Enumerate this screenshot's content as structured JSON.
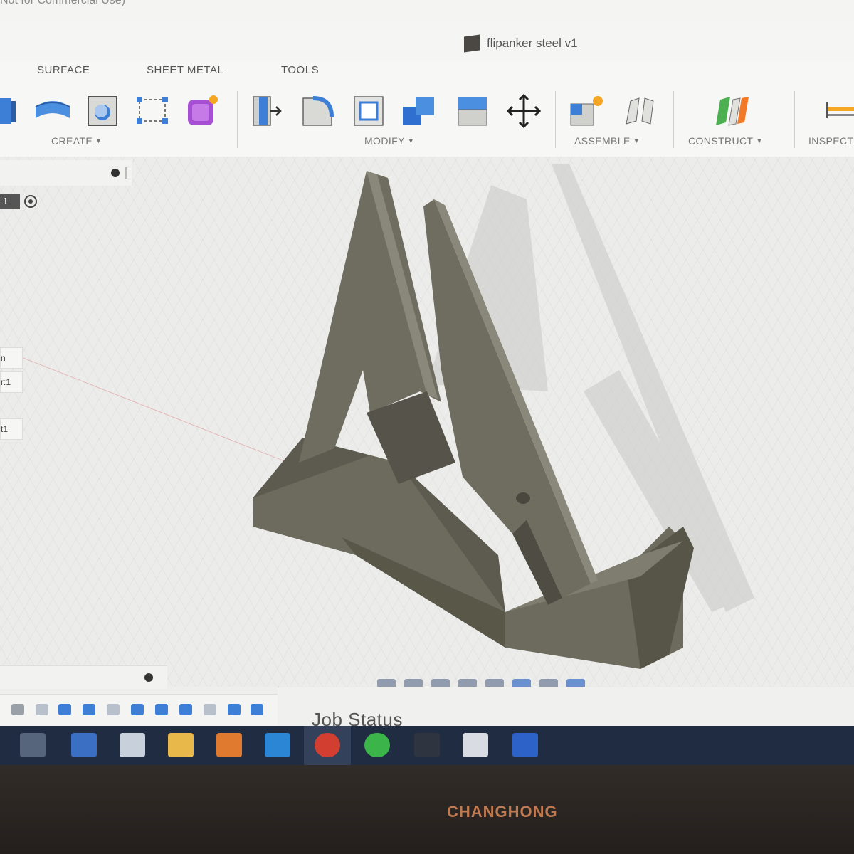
{
  "license_notice": "Not for Commercial Use)",
  "document": {
    "title": "flipanker steel v1"
  },
  "ribbon": {
    "tabs": [
      "SURFACE",
      "SHEET METAL",
      "TOOLS"
    ],
    "groups": {
      "create": "CREATE",
      "modify": "MODIFY",
      "assemble": "ASSEMBLE",
      "construct": "CONSTRUCT",
      "inspect": "INSPECT"
    }
  },
  "browser": {
    "chip_label": "1",
    "rows": [
      "n",
      "r:1",
      "t1"
    ]
  },
  "job_status": {
    "label": "Job Status"
  },
  "monitor": {
    "brand": "CHANGHONG"
  },
  "colors": {
    "model": "#6f6d60",
    "model_dark": "#4f4d43",
    "model_light": "#8a887a",
    "taskbar": "#1f2c42",
    "brand": "#c07a52"
  },
  "taskbar_icons": [
    "task-view-icon",
    "mail-icon",
    "store-icon",
    "file-explorer-icon",
    "fusion-app-icon",
    "cortana-icon",
    "chrome-icon",
    "whatsapp-icon",
    "tx-app-icon",
    "image-viewer-icon",
    "checkmark-app-icon"
  ]
}
